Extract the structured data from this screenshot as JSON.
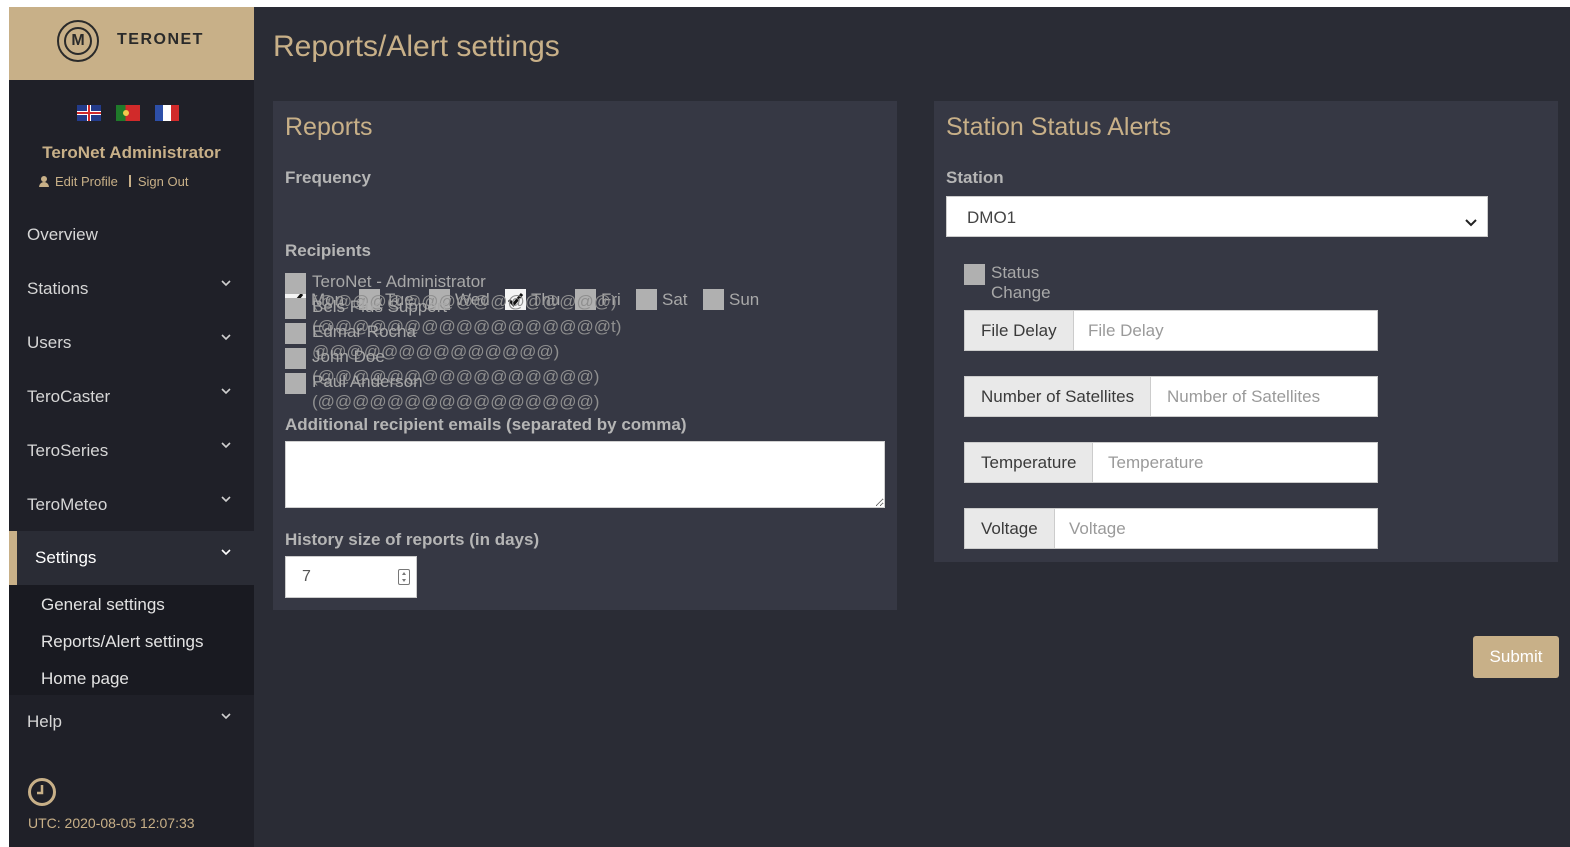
{
  "brand": {
    "name": "TERONET",
    "logo_letter": "M"
  },
  "user": {
    "name": "TeroNet Administrator",
    "edit_profile": "Edit Profile",
    "sign_out": "Sign Out"
  },
  "languages": [
    "en",
    "pt",
    "fr"
  ],
  "nav": {
    "overview": "Overview",
    "stations": "Stations",
    "users": "Users",
    "terocaster": "TeroCaster",
    "teroseries": "TeroSeries",
    "terometeo": "TeroMeteo",
    "settings": "Settings",
    "help": "Help",
    "settings_sub": [
      "General settings",
      "Reports/Alert settings",
      "Home page"
    ]
  },
  "clock": {
    "utc": "UTC: 2020-08-05 12:07:33"
  },
  "page": {
    "title": "Reports/Alert settings"
  },
  "reports": {
    "title": "Reports",
    "frequency_label": "Frequency",
    "days": [
      {
        "label": "Mon",
        "checked": true
      },
      {
        "label": "Tue",
        "checked": false
      },
      {
        "label": "Wed",
        "checked": false
      },
      {
        "label": "Thu",
        "checked": true
      },
      {
        "label": "Fri",
        "checked": false
      },
      {
        "label": "Sat",
        "checked": false
      },
      {
        "label": "Sun",
        "checked": false
      }
    ],
    "recipients_label": "Recipients",
    "recipients": [
      {
        "name": "TeroNet - Administrator",
        "email_redacted": "(@@@@@@@@@@@@@@@@@)",
        "checked": false
      },
      {
        "name": "Bels Plus Support",
        "email_redacted": "(@@@@@@@@@@@@@@@@@t)",
        "checked": false
      },
      {
        "name": "Edmar Rocha",
        "email_redacted": "@@@@@@@@@@@@@@)",
        "checked": false
      },
      {
        "name": "John Doe",
        "email_redacted": "(@@@@@@@@@@@@@@@@)",
        "checked": false
      },
      {
        "name": "Paul Anderson",
        "email_redacted": "(@@@@@@@@@@@@@@@@)",
        "checked": false
      }
    ],
    "additional_label": "Additional recipient emails (separated by comma)",
    "additional_value": "",
    "history_label": "History size of reports (in days)",
    "history_value": "7"
  },
  "alerts": {
    "title": "Station Status Alerts",
    "station_label": "Station",
    "station_value": "DMO1",
    "status_change_label": "Status Change",
    "status_change_checked": false,
    "file_delay": {
      "label": "File Delay",
      "placeholder": "File Delay"
    },
    "satellites": {
      "label": "Number of Satellites",
      "placeholder": "Number of Satellites"
    },
    "temperature": {
      "label": "Temperature",
      "placeholder": "Temperature"
    },
    "voltage": {
      "label": "Voltage",
      "placeholder": "Voltage"
    }
  },
  "actions": {
    "submit": "Submit"
  },
  "colors": {
    "accent": "#c8b088",
    "background": "#2a2c35",
    "sidebar": "#1f2028",
    "panel": "#363844"
  }
}
